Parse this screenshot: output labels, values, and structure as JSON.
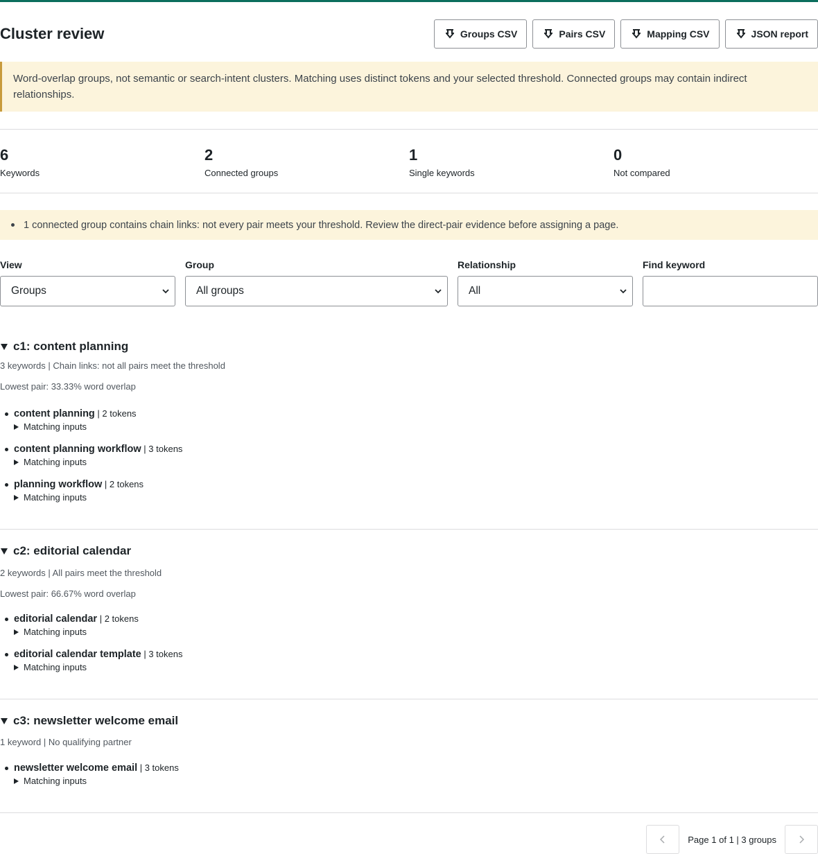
{
  "page": {
    "title": "Cluster review"
  },
  "exports": [
    {
      "label": "Groups CSV",
      "icon": "download-icon"
    },
    {
      "label": "Pairs CSV",
      "icon": "download-icon"
    },
    {
      "label": "Mapping CSV",
      "icon": "download-icon"
    },
    {
      "label": "JSON report",
      "icon": "download-icon"
    }
  ],
  "notice": "Word-overlap groups, not semantic or search-intent clusters. Matching uses distinct tokens and your selected threshold. Connected groups may contain indirect relationships.",
  "stats": [
    {
      "value": "6",
      "label": "Keywords"
    },
    {
      "value": "2",
      "label": "Connected groups"
    },
    {
      "value": "1",
      "label": "Single keywords"
    },
    {
      "value": "0",
      "label": "Not compared"
    }
  ],
  "warning": "1 connected group contains chain links: not every pair meets your threshold. Review the direct-pair evidence before assigning a page.",
  "filters": {
    "view": {
      "label": "View",
      "value": "Groups"
    },
    "group": {
      "label": "Group",
      "value": "All groups"
    },
    "relationship": {
      "label": "Relationship",
      "value": "All"
    },
    "find": {
      "label": "Find keyword",
      "value": ""
    }
  },
  "groups": [
    {
      "title": "c1: content planning",
      "meta": "3 keywords | Chain links: not all pairs meet the threshold",
      "lowest": "Lowest pair: 33.33% word overlap",
      "keywords": [
        {
          "name": "content planning",
          "tokens": "2 tokens",
          "toggle": "Matching inputs"
        },
        {
          "name": "content planning workflow",
          "tokens": "3 tokens",
          "toggle": "Matching inputs"
        },
        {
          "name": "planning workflow",
          "tokens": "2 tokens",
          "toggle": "Matching inputs"
        }
      ]
    },
    {
      "title": "c2: editorial calendar",
      "meta": "2 keywords | All pairs meet the threshold",
      "lowest": "Lowest pair: 66.67% word overlap",
      "keywords": [
        {
          "name": "editorial calendar",
          "tokens": "2 tokens",
          "toggle": "Matching inputs"
        },
        {
          "name": "editorial calendar template",
          "tokens": "3 tokens",
          "toggle": "Matching inputs"
        }
      ]
    },
    {
      "title": "c3: newsletter welcome email",
      "meta": "1 keyword | No qualifying partner",
      "lowest": "",
      "keywords": [
        {
          "name": "newsletter welcome email",
          "tokens": "3 tokens",
          "toggle": "Matching inputs"
        }
      ]
    }
  ],
  "pager": {
    "prefix": "Page ",
    "current": "1",
    "of": " of ",
    "total": "1",
    "suffix": " | 3 groups"
  }
}
